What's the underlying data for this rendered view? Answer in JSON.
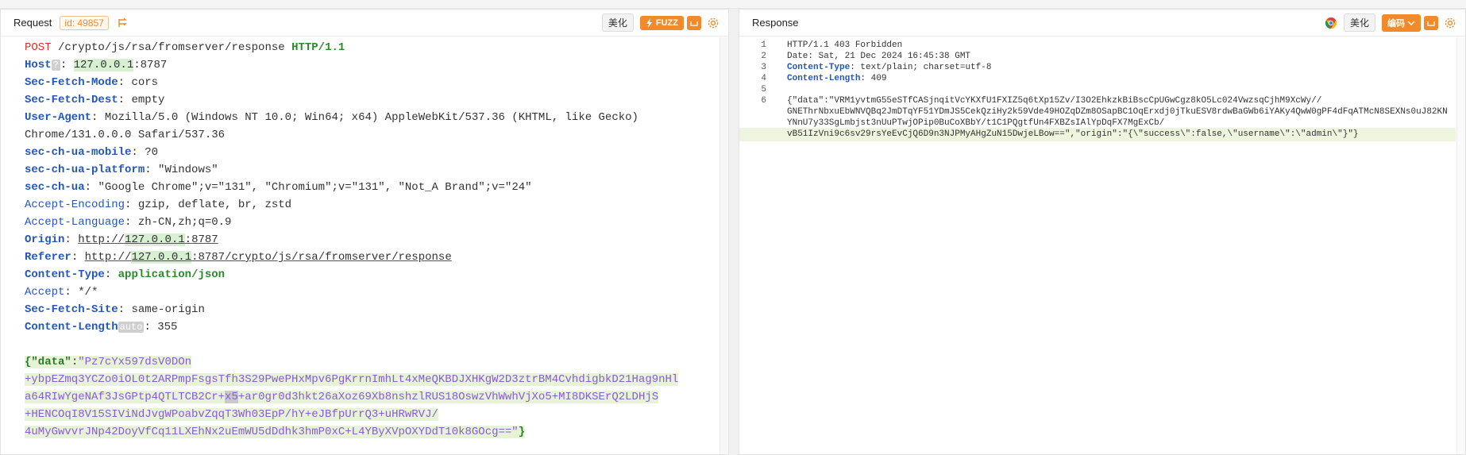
{
  "request": {
    "title": "Request",
    "id_badge": "id: 49857",
    "beautify_label": "美化",
    "fuzz_label": "FUZZ",
    "line1": {
      "method": "POST",
      "path": " /crypto/js/rsa/fromserver/response ",
      "proto": "HTTP/1.1"
    },
    "host": {
      "key": "Host",
      "hint": "?",
      "sep": ": ",
      "ip": "127.0.0.1",
      "port": ":8787"
    },
    "headers": [
      {
        "key": "Sec-Fetch-Mode",
        "value": "cors"
      },
      {
        "key": "Sec-Fetch-Dest",
        "value": "empty"
      },
      {
        "key": "User-Agent",
        "value": "Mozilla/5.0 (Windows NT 10.0; Win64; x64) AppleWebKit/537.36 (KHTML, like Gecko)"
      },
      {
        "key": "",
        "value": "Chrome/131.0.0.0 Safari/537.36"
      },
      {
        "key": "sec-ch-ua-mobile",
        "value": "?0"
      },
      {
        "key": "sec-ch-ua-platform",
        "value": "\"Windows\""
      },
      {
        "key": "sec-ch-ua",
        "value": "\"Google Chrome\";v=\"131\", \"Chromium\";v=\"131\", \"Not_A Brand\";v=\"24\""
      }
    ],
    "accept_encoding": {
      "key": "Accept-Encoding",
      "value": "gzip, deflate, br, zstd"
    },
    "accept_language": {
      "key": "Accept-Language",
      "value": "zh-CN,zh;q=0.9"
    },
    "origin": {
      "key": "Origin",
      "prefix": "http://",
      "ip": "127.0.0.1",
      "suffix": ":8787"
    },
    "referer": {
      "key": "Referer",
      "prefix": "http://",
      "ip": "127.0.0.1",
      "suffix": ":8787/crypto/js/rsa/fromserver/response"
    },
    "content_type": {
      "key": "Content-Type",
      "value": "application/json"
    },
    "accept": {
      "key": "Accept",
      "value": "*/*"
    },
    "sec_fetch_site": {
      "key": "Sec-Fetch-Site",
      "value": "same-origin"
    },
    "content_length": {
      "key": "Content-Length",
      "hint": "auto",
      "value": "355"
    },
    "body": {
      "open": "{",
      "key": "\"data\"",
      "colon": ":",
      "line1": "\"Pz7cYx597dsV0DOn",
      "line2": "+ybpEZmq3YCZo0iOL0t2ARPmpFsgsTfh3S29PwePHxMpv6PgKrrnImhLt4xMeQKBDJXHKgW2D3ztrBM4CvhdigbkD21Hag9nHl",
      "line3a": "a64RIwYgeNAf3JsGPtp4QTLTCB2Cr+",
      "line3sel": "x5",
      "line3b": "+ar0gr0d3hkt26aXoz69Xb8nshzlRUS18OswzVhWwhVjXo5+MI8DKSErQ2LDHjS",
      "line4": "+HENCOqI8V15SIViNdJvgWPoabvZqqT3Wh03EpP/hY+eJBfpUrrQ3+uHRwRVJ/",
      "line5": "4uMyGwvvrJNp42DoyVfCq11LXEhNx2uEmWU5dDdhk3hmP0xC+L4YByXVpOXYDdT10k8GOcg==\"",
      "close": "}"
    }
  },
  "response": {
    "title": "Response",
    "beautify_label": "美化",
    "encode_label": "编码",
    "lines": {
      "n1": "1",
      "n2": "2",
      "n3": "3",
      "n4": "4",
      "n5": "5",
      "n6": "6",
      "status": "HTTP/1.1 403 Forbidden",
      "date": "Date: Sat, 21 Dec 2024 16:45:38 GMT",
      "ct_key": "Content-Type",
      "ct_val": ": text/plain; charset=utf-8",
      "cl_key": "Content-Length",
      "cl_val": ": 409",
      "body1": "{\"data\":\"VRM1yvtmG55eSTfCASjnqitVcYKXfU1FXIZ5q6tXp15Zv/I3O2EhkzkBiBscCpUGwCgz8kO5Lc024VwzsqCjhM9XcWy//",
      "body2": "GNEThrNbxuEbWNVQBq2JmDTqYF51YDmJS5CekQziHy2k59Vde49HOZqDZm8OSapBC1OqErxdj0jTkuESV8rdwBaGWb6iYAKy4QwW0gPF4dFqATMcN8SEXNs0uJ82KN",
      "body3": "YNnU7y33SgLmbjst3nUuPTwjOPip0BuCoXBbY/t1C1PQgtfUn4FXBZsIAlYpDqFX7MgExCb/",
      "body4": "vB51IzVni9c6sv29rsYeEvCjQ6D9n3NJPMyAHgZuN15DwjeLBow==\",\"origin\":\"{\\\"success\\\":false,\\\"username\\\":\\\"admin\\\"}\"}"
    }
  },
  "colors": {
    "accent": "#f08a2a",
    "header_key": "#2457b8",
    "method": "#d0342c",
    "json_string": "#8a5bd6"
  }
}
